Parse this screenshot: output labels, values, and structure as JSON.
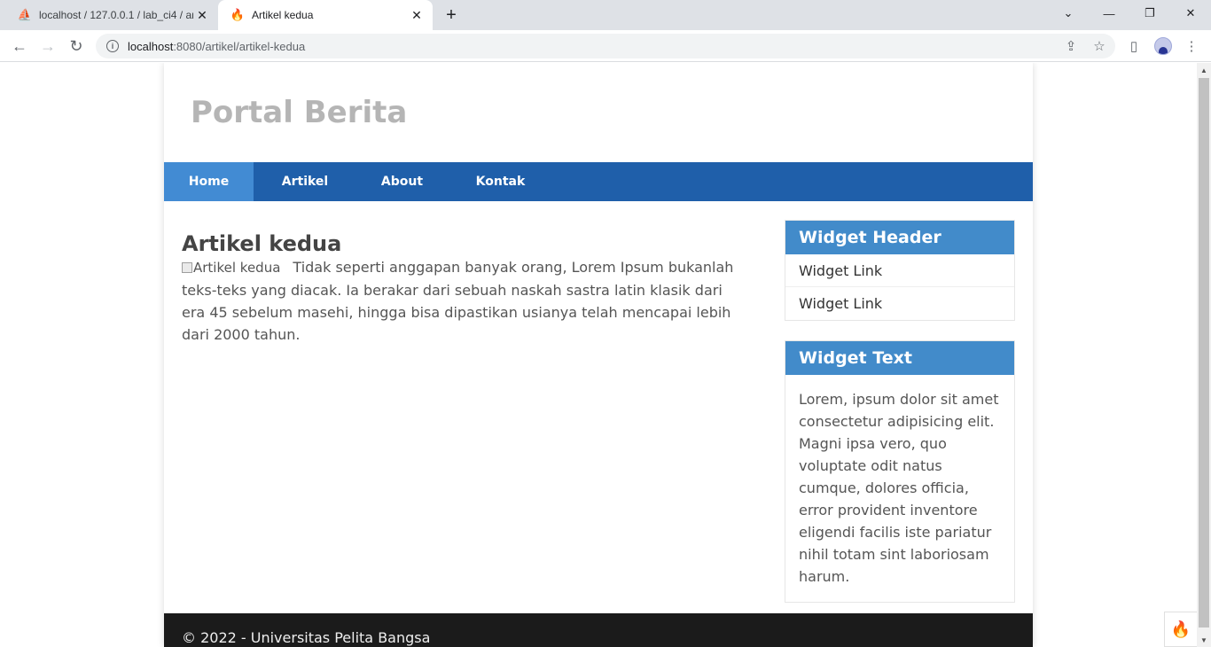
{
  "browser": {
    "tabs": [
      {
        "title": "localhost / 127.0.0.1 / lab_ci4 / ar",
        "favicon": "phpmyadmin-icon",
        "active": false
      },
      {
        "title": "Artikel kedua",
        "favicon": "codeigniter-flame-icon",
        "active": true
      }
    ],
    "url_host": "localhost",
    "url_path": ":8080/artikel/artikel-kedua"
  },
  "site": {
    "title": "Portal Berita",
    "nav": [
      {
        "label": "Home",
        "active": true
      },
      {
        "label": "Artikel",
        "active": false
      },
      {
        "label": "About",
        "active": false
      },
      {
        "label": "Kontak",
        "active": false
      }
    ]
  },
  "article": {
    "title": "Artikel kedua",
    "image_alt": "Artikel kedua",
    "body": "Tidak seperti anggapan banyak orang, Lorem Ipsum bukanlah teks-teks yang diacak. Ia berakar dari sebuah naskah sastra latin klasik dari era 45 sebelum masehi, hingga bisa dipastikan usianya telah mencapai lebih dari 2000 tahun."
  },
  "sidebar": {
    "widget1": {
      "header": "Widget Header",
      "links": [
        "Widget Link",
        "Widget Link"
      ]
    },
    "widget2": {
      "header": "Widget Text",
      "text": "Lorem, ipsum dolor sit amet consectetur adipisicing elit. Magni ipsa vero, quo voluptate odit natus cumque, dolores officia, error provident inventore eligendi facilis iste pariatur nihil totam sint laboriosam harum."
    }
  },
  "footer": {
    "text": "© 2022 - Universitas Pelita Bangsa"
  },
  "colors": {
    "nav_bg": "#1f5faa",
    "nav_active": "#428bd3",
    "widget_header": "#428bca",
    "footer_bg": "#1b1b1b"
  }
}
